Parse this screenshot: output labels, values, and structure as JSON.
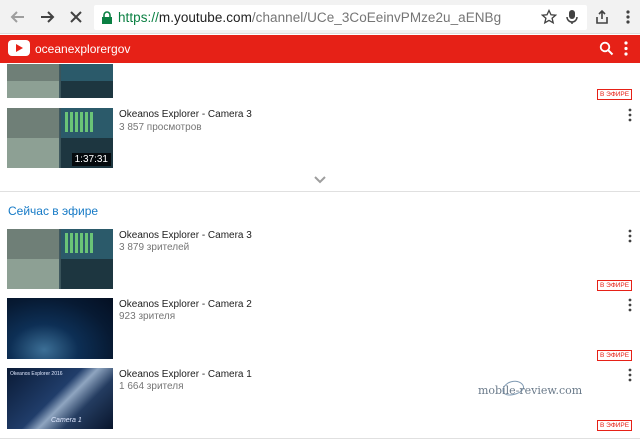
{
  "browser": {
    "url_scheme": "https://",
    "url_host": "m.youtube.com",
    "url_path": "/channel/UCe_3CoEeinvPMze2u_aENBg"
  },
  "youtube": {
    "channel_name": "oceanexplorergov",
    "accent_color": "#e62117"
  },
  "uploads": {
    "items": [
      {
        "title": "Okeanos Explorer - Camera 3",
        "meta": "3 857 просмотров",
        "duration": "1:37:31"
      }
    ],
    "partial_live_badge": "В ЭФИРЕ"
  },
  "live_section": {
    "title": "Сейчас в эфире",
    "items": [
      {
        "title": "Okeanos Explorer - Camera 3",
        "meta": "3 879 зрителей",
        "badge": "В ЭФИРЕ"
      },
      {
        "title": "Okeanos Explorer - Camera 2",
        "meta": "923 зрителя",
        "badge": "В ЭФИРЕ"
      },
      {
        "title": "Okeanos Explorer - Camera 1",
        "meta": "1 664 зрителя",
        "badge": "В ЭФИРЕ"
      }
    ]
  },
  "thumb_captions": {
    "cam1": "Okeanos Explorer 2016",
    "cam1_overlay": "Camera 1"
  },
  "watermark": "mobile-review.com"
}
